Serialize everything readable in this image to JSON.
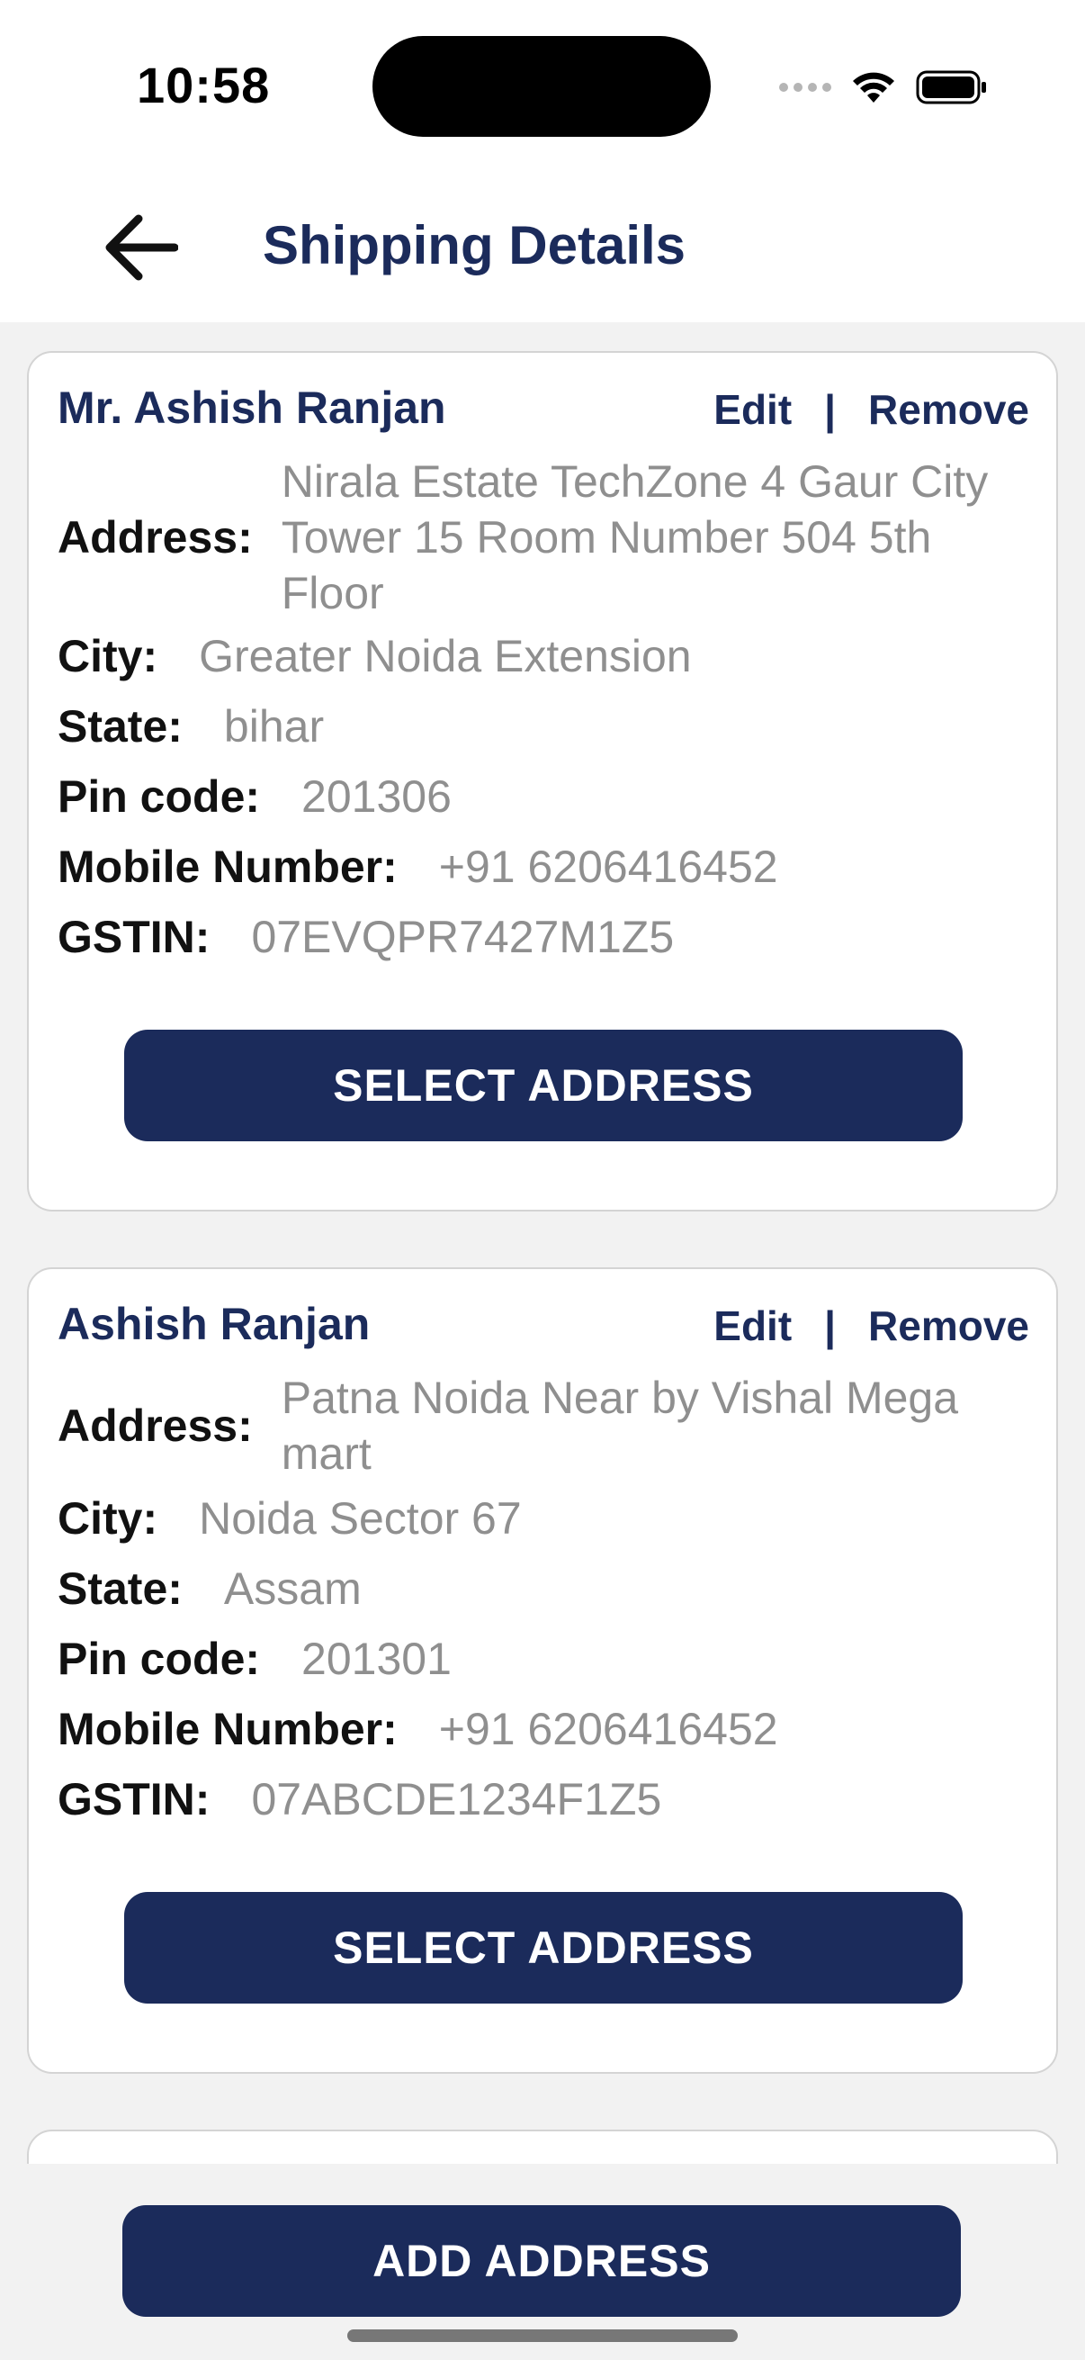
{
  "status_bar": {
    "time": "10:58",
    "icons": [
      "signal-dots-icon",
      "wifi-icon",
      "battery-icon"
    ]
  },
  "header": {
    "title": "Shipping Details",
    "back_icon": "arrow-left-icon"
  },
  "colors": {
    "primary": "#1b2b5b",
    "value_text": "#8f8f8f",
    "background": "#f2f2f2"
  },
  "labels": {
    "address": "Address:",
    "city": "City:",
    "state": "State:",
    "pin": "Pin code:",
    "mobile": "Mobile Number:",
    "gstin": "GSTIN:",
    "edit": "Edit",
    "separator": "|",
    "remove": "Remove",
    "select_address": "SELECT ADDRESS"
  },
  "addresses": [
    {
      "name": "Mr. Ashish Ranjan",
      "address": "Nirala Estate TechZone 4 Gaur City Tower 15 Room Number 504 5th Floor",
      "city": "Greater Noida Extension",
      "state": "bihar",
      "pin": "201306",
      "mobile": "+91 6206416452",
      "gstin": "07EVQPR7427M1Z5"
    },
    {
      "name": "Ashish Ranjan",
      "address": "Patna Noida Near by Vishal Mega mart",
      "city": "Noida Sector 67",
      "state": "Assam",
      "pin": "201301",
      "mobile": "+91 6206416452",
      "gstin": "07ABCDE1234F1Z5"
    }
  ],
  "footer": {
    "add_address": "ADD ADDRESS"
  }
}
